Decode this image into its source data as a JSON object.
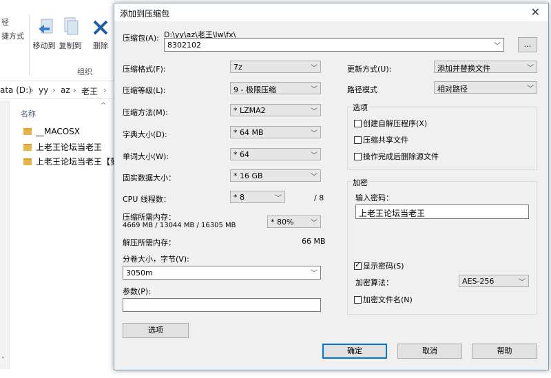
{
  "explorer": {
    "ribbon_top_left_1": "径",
    "ribbon_top_left_2": "捷方式",
    "move_to": "移动到",
    "copy_to": "复制到",
    "delete": "删除",
    "group_label": "组织",
    "address": [
      "ata (D:)",
      "›",
      "yy",
      "›",
      "az",
      "›",
      "老王",
      "›"
    ],
    "column_name": "名称",
    "files": [
      "__MACOSX",
      "上老王论坛当老王",
      "上老王论坛当老王【萝"
    ]
  },
  "dialog": {
    "title": "添加到压缩包",
    "archive_label": "压缩包(A):",
    "archive_path": "D:\\yy\\az\\老王\\lw\\fx\\",
    "archive_name": "8302102",
    "browse_label": "...",
    "format_label": "压缩格式(F):",
    "format_value": "7z",
    "level_label": "压缩等级(L):",
    "level_value": "9 - 极限压缩",
    "method_label": "压缩方法(M):",
    "method_value": "* LZMA2",
    "dict_label": "字典大小(D):",
    "dict_value": "* 64 MB",
    "word_label": "单词大小(W):",
    "word_value": "* 64",
    "solid_label": "固实数据大小：",
    "solid_value": "* 16 GB",
    "cpu_label": "CPU 线程数：",
    "cpu_value": "* 8",
    "cpu_max": "/ 8",
    "mem_label": "压缩所需内存：",
    "mem_detail": "4669 MB / 13044 MB / 16305 MB",
    "mem_value": "* 80%",
    "decomp_label": "解压所需内存：",
    "decomp_value": "66 MB",
    "split_label": "分卷大小，字节(V):",
    "split_value": "3050m",
    "params_label": "参数(P):",
    "params_value": "",
    "options_button": "选项",
    "update_label": "更新方式(U):",
    "update_value": "添加并替换文件",
    "path_label": "路径模式",
    "path_value": "相对路径",
    "options_group": "选项",
    "opt_sfx": "创建自解压程序(X)",
    "opt_shared": "压缩共享文件",
    "opt_delete": "操作完成后删除源文件",
    "encrypt_group": "加密",
    "password_label": "输入密码：",
    "password_value": "上老王论坛当老王",
    "show_password": "显示密码(S)",
    "enc_method_label": "加密算法：",
    "enc_method_value": "AES-256",
    "enc_names": "加密文件名(N)",
    "ok": "确定",
    "cancel": "取消",
    "help": "帮助"
  }
}
